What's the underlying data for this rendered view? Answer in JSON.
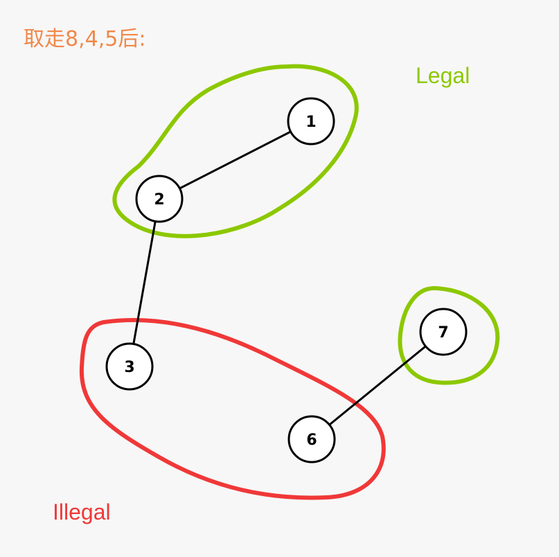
{
  "title": "取走8,4,5后:",
  "colors": {
    "title": "#f0884a",
    "legal": "#8cc800",
    "illegal": "#f03838"
  },
  "regions": {
    "legal_label": "Legal",
    "illegal_label": "Illegal"
  },
  "nodes": [
    {
      "id": "1",
      "label": "1"
    },
    {
      "id": "2",
      "label": "2"
    },
    {
      "id": "3",
      "label": "3"
    },
    {
      "id": "6",
      "label": "6"
    },
    {
      "id": "7",
      "label": "7"
    }
  ],
  "edges": [
    {
      "from": "1",
      "to": "2"
    },
    {
      "from": "2",
      "to": "3"
    },
    {
      "from": "6",
      "to": "7"
    }
  ],
  "groups": [
    {
      "type": "legal",
      "members": [
        "1",
        "2"
      ]
    },
    {
      "type": "legal",
      "members": [
        "7"
      ]
    },
    {
      "type": "illegal",
      "members": [
        "3",
        "6"
      ]
    }
  ]
}
